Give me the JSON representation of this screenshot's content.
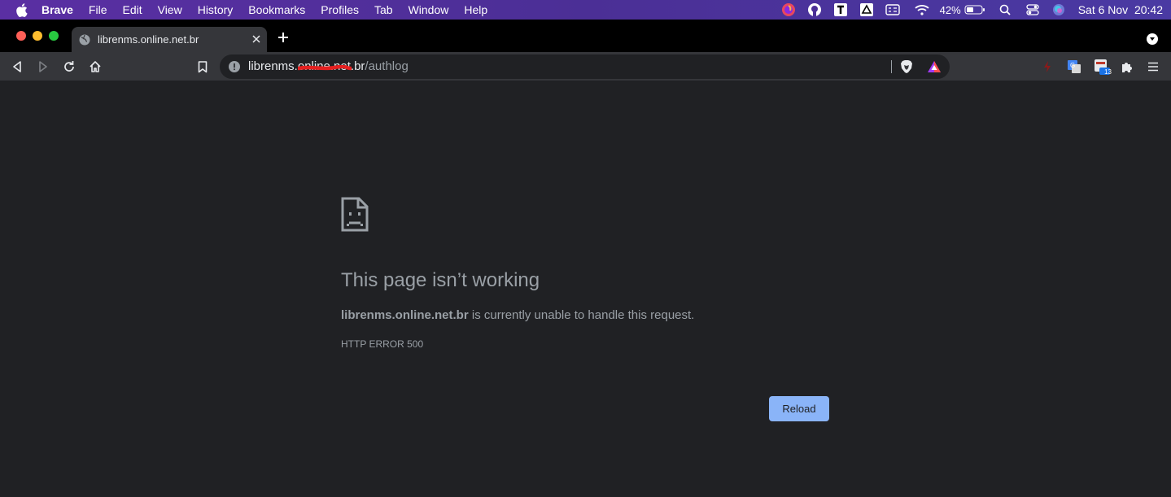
{
  "menubar": {
    "items": [
      "Brave",
      "File",
      "Edit",
      "View",
      "History",
      "Bookmarks",
      "Profiles",
      "Tab",
      "Window",
      "Help"
    ],
    "battery": "42%",
    "clock": "Sat 6 Nov  20:42",
    "status_icons": [
      "firefox-icon",
      "github-icon",
      "typora-icon",
      "google-drive-icon",
      "keyboard-icon",
      "wifi-icon",
      "battery-icon",
      "spotlight-icon",
      "control-center-icon",
      "siri-icon"
    ]
  },
  "tabs": [
    {
      "title": "librenms.online.net.br",
      "active": true
    }
  ],
  "toolbar": {
    "url_host_visible": "librenms.online.net.br",
    "url_path": "/authlog"
  },
  "extensions": [
    {
      "name": "tag-extension-icon"
    },
    {
      "name": "google-translate-icon"
    },
    {
      "name": "calendar-extension-icon",
      "badge": "13"
    },
    {
      "name": "puzzle-icon"
    }
  ],
  "error": {
    "heading": "This page isn’t working",
    "host": "librenms.online.net.br",
    "message": " is currently unable to handle this request.",
    "code": "HTTP ERROR 500",
    "reload_label": "Reload"
  },
  "colors": {
    "page_bg": "#202124",
    "toolbar_bg": "#35363a",
    "accent_button": "#8ab4f8",
    "menubar_bg": "#4b2f96",
    "redaction": "#e52020"
  }
}
